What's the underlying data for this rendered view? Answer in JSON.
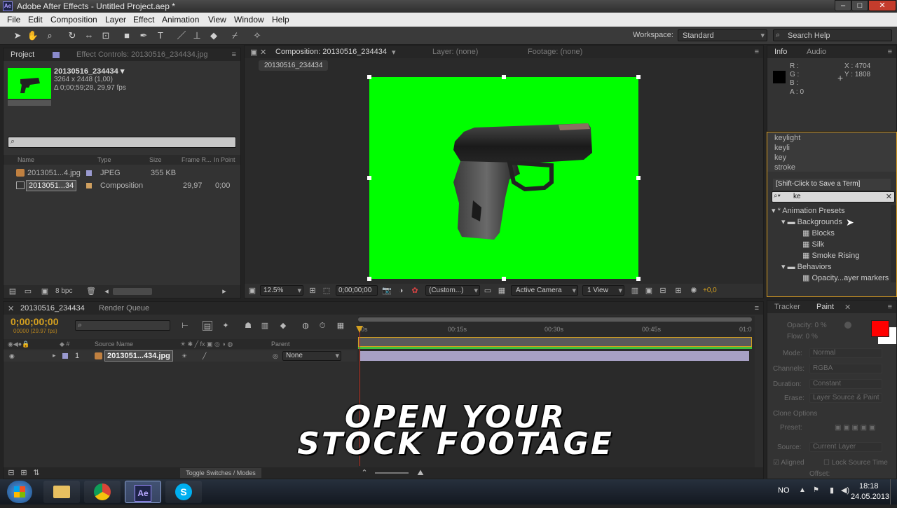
{
  "window": {
    "title": "Adobe After Effects - Untitled Project.aep *",
    "app_icon": "Ae"
  },
  "menu": [
    "File",
    "Edit",
    "Composition",
    "Layer",
    "Effect",
    "Animation",
    "View",
    "Window",
    "Help"
  ],
  "toolbar": {
    "workspace_label": "Workspace:",
    "workspace_value": "Standard",
    "search_help": "Search Help"
  },
  "project_panel": {
    "tab_project": "Project",
    "tab_effect_controls": "Effect Controls: 20130516_234434.jpg",
    "item_name": "20130516_234434 ▾",
    "item_size": "3264 x 2448 (1,00)",
    "item_duration": "Δ 0;00;59;28, 29,97 fps",
    "search_placeholder": "",
    "columns": [
      "Name",
      "Type",
      "Size",
      "Frame R...",
      "In Point"
    ],
    "rows": [
      {
        "name": "2013051...4.jpg",
        "type": "JPEG",
        "size": "355 KB",
        "fps": "",
        "in": "",
        "color": "#9a9ad0"
      },
      {
        "name": "2013051...34",
        "type": "Composition",
        "size": "",
        "fps": "29,97",
        "in": "0;00",
        "color": "#d0a060"
      }
    ],
    "bpc": "8 bpc"
  },
  "comp_panel": {
    "tab_comp": "Composition: 20130516_234434",
    "tab_layer": "Layer: (none)",
    "tab_footage": "Footage: (none)",
    "comp_subtab": "20130516_234434",
    "zoom": "12.5%",
    "timecode": "0;00;00;00",
    "resolution": "(Custom...)",
    "camera": "Active Camera",
    "view": "1 View",
    "exposure": "+0,0",
    "bg_color": "#00ff00"
  },
  "info_panel": {
    "tab_info": "Info",
    "tab_audio": "Audio",
    "r": "R :",
    "g": "G :",
    "b": "B :",
    "a": "A : 0",
    "x": "X : 4704",
    "y": "Y : 1808"
  },
  "effects_panel": {
    "history": [
      "keylight",
      "keyli",
      "key",
      "stroke"
    ],
    "save_term": "[Shift-Click to Save a Term]",
    "search_value": "ke",
    "tree": [
      {
        "label": "* Animation Presets",
        "level": 0,
        "kind": "root"
      },
      {
        "label": "Backgrounds",
        "level": 1,
        "kind": "folder"
      },
      {
        "label": "Blocks",
        "level": 2,
        "kind": "preset"
      },
      {
        "label": "Silk",
        "level": 2,
        "kind": "preset"
      },
      {
        "label": "Smoke Rising",
        "level": 2,
        "kind": "preset"
      },
      {
        "label": "Behaviors",
        "level": 1,
        "kind": "folder"
      },
      {
        "label": "Opacity...ayer markers",
        "level": 2,
        "kind": "preset"
      }
    ]
  },
  "timeline": {
    "tab_comp": "20130516_234434",
    "tab_render": "Render Queue",
    "timecode": "0;00;00;00",
    "timecode_sub": "00000 (29.97 fps)",
    "col_source": "Source Name",
    "col_parent": "Parent",
    "ruler": [
      "0s",
      "00:15s",
      "00:30s",
      "00:45s",
      "01:0"
    ],
    "layer": {
      "num": "1",
      "name": "2013051...434.jpg",
      "parent": "None"
    },
    "toggle_label": "Toggle Switches / Modes"
  },
  "paint_panel": {
    "tab_tracker": "Tracker",
    "tab_paint": "Paint",
    "opacity": "Opacity: 0 %",
    "flow": "Flow: 0 %",
    "mode_label": "Mode:",
    "mode_value": "Normal",
    "channels_label": "Channels:",
    "channels_value": "RGBA",
    "duration_label": "Duration:",
    "duration_value": "Constant",
    "erase_label": "Erase:",
    "erase_value": "Layer Source & Paint",
    "clone_label": "Clone Options",
    "preset_label": "Preset:",
    "source_label": "Source:",
    "source_value": "Current Layer",
    "aligned": "Aligned",
    "lock_source": "Lock Source Time",
    "offset": "Offset:",
    "fg_color": "#ff0000",
    "bg_color": "#ffffff"
  },
  "overlay": {
    "line1": "OPEN YOUR",
    "line2": "STOCK FOOTAGE"
  },
  "taskbar": {
    "lang": "NO",
    "time": "18:18",
    "date": "24.05.2013",
    "ae_label": "Ae",
    "skype_label": "S"
  }
}
